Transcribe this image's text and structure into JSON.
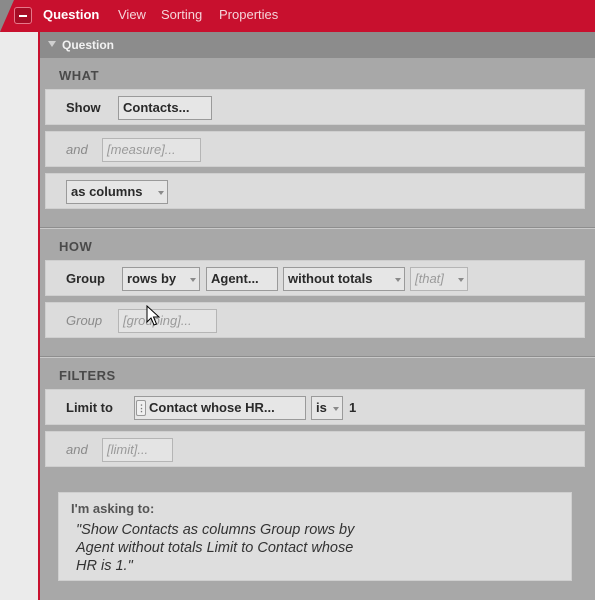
{
  "menubar": {
    "items": [
      "Question",
      "View",
      "Sorting",
      "Properties"
    ],
    "active": "Question"
  },
  "panel": {
    "title": "Question"
  },
  "what": {
    "label": "WHAT",
    "show_label": "Show",
    "show_value": "Contacts...",
    "and_label": "and",
    "measure_placeholder": "[measure]...",
    "layout_value": "as columns"
  },
  "how": {
    "label": "HOW",
    "group_label": "Group",
    "group_mode": "rows by",
    "group_by": "Agent...",
    "totals": "without totals",
    "that_placeholder": "[that]",
    "group2_label": "Group",
    "grouping_placeholder": "[grouping]..."
  },
  "filters": {
    "label": "FILTERS",
    "limit_label": "Limit to",
    "limit_field": "Contact whose HR...",
    "operator": "is",
    "value": "1",
    "and_label": "and",
    "limit_placeholder": "[limit]..."
  },
  "summary": {
    "heading": "I'm asking to:",
    "text": "\"Show Contacts as columns Group rows by Agent without totals Limit to Contact whose HR is 1.\""
  },
  "colors": {
    "brand_red": "#c8102e",
    "panel_gray": "#a8a8a8",
    "row_gray": "#dcdcdc"
  }
}
